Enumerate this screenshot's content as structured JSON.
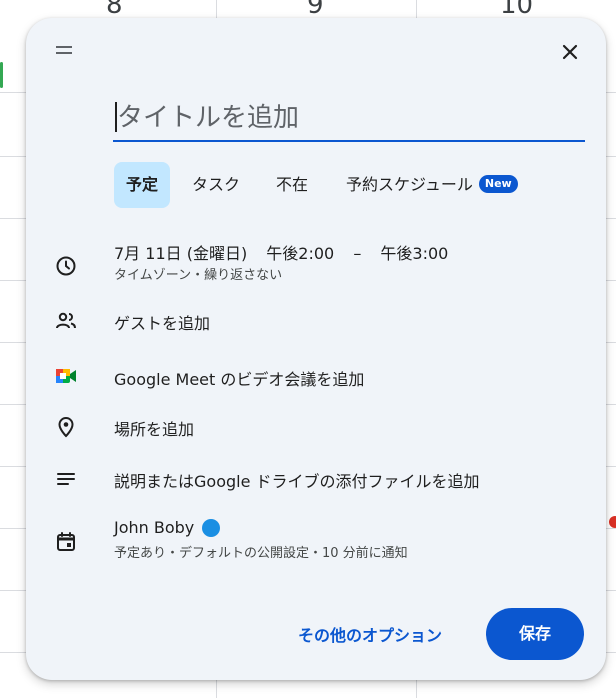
{
  "background": {
    "hours": [
      "8",
      "9",
      "10"
    ]
  },
  "dialog": {
    "title_placeholder": "タイトルを追加",
    "tabs": [
      {
        "label": "予定",
        "active": true
      },
      {
        "label": "タスク",
        "active": false
      },
      {
        "label": "不在",
        "active": false
      },
      {
        "label": "予約スケジュール",
        "active": false,
        "badge": "New"
      }
    ],
    "datetime": {
      "date": "7月 11日 (金曜日)",
      "start": "午後2:00",
      "separator": "–",
      "end": "午後3:00",
      "sub": "タイムゾーン・繰り返さない"
    },
    "guests_label": "ゲストを追加",
    "meet_label": "Google Meet のビデオ会議を追加",
    "location_label": "場所を追加",
    "description_label": "説明またはGoogle ドライブの添付ファイルを追加",
    "calendar": {
      "name": "John Boby",
      "sub": "予定あり・デフォルトの公開設定・10 分前に通知"
    },
    "more_options_label": "その他のオプション",
    "save_label": "保存"
  },
  "colors": {
    "accent": "#0b57d0",
    "dialog_bg": "#f0f4f9",
    "active_tab_bg": "#c2e7ff",
    "calendar_dot": "#1a8fe3"
  }
}
